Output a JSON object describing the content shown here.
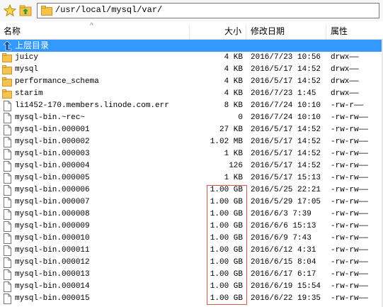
{
  "toolbar": {
    "favorite_icon": "star-icon",
    "up_icon": "folder-up-icon",
    "path": "/usr/local/mysql/var/"
  },
  "columns": {
    "name": "名称",
    "size": "大小",
    "modified": "修改日期",
    "attributes": "属性"
  },
  "parent_row": {
    "label": "上层目录",
    "icon": "parent-dir-icon"
  },
  "colors": {
    "selection": "#3399ff",
    "folder": "#f4c34b",
    "highlight_border": "#d9534f"
  },
  "files": [
    {
      "name": "juicy",
      "size": "4 KB",
      "date": "2016/7/23 10:56",
      "attr": "drwx——",
      "type": "folder"
    },
    {
      "name": "mysql",
      "size": "4 KB",
      "date": "2016/5/17 14:52",
      "attr": "drwx——",
      "type": "folder"
    },
    {
      "name": "performance_schema",
      "size": "4 KB",
      "date": "2016/5/17 14:52",
      "attr": "drwx——",
      "type": "folder"
    },
    {
      "name": "starim",
      "size": "4 KB",
      "date": "2016/7/23 1:45",
      "attr": "drwx——",
      "type": "folder"
    },
    {
      "name": "li1452-170.members.linode.com.err",
      "size": "8 KB",
      "date": "2016/7/24 10:10",
      "attr": "-rw-r——",
      "type": "file"
    },
    {
      "name": "mysql-bin.~rec~",
      "size": "0",
      "date": "2016/7/24 10:10",
      "attr": "-rw-rw——",
      "type": "file"
    },
    {
      "name": "mysql-bin.000001",
      "size": "27 KB",
      "date": "2016/5/17 14:52",
      "attr": "-rw-rw——",
      "type": "file"
    },
    {
      "name": "mysql-bin.000002",
      "size": "1.02 MB",
      "date": "2016/5/17 14:52",
      "attr": "-rw-rw——",
      "type": "file"
    },
    {
      "name": "mysql-bin.000003",
      "size": "1 KB",
      "date": "2016/5/17 14:52",
      "attr": "-rw-rw——",
      "type": "file"
    },
    {
      "name": "mysql-bin.000004",
      "size": "126",
      "date": "2016/5/17 14:52",
      "attr": "-rw-rw——",
      "type": "file"
    },
    {
      "name": "mysql-bin.000005",
      "size": "1 KB",
      "date": "2016/5/17 15:13",
      "attr": "-rw-rw——",
      "type": "file"
    },
    {
      "name": "mysql-bin.000006",
      "size": "1.00 GB",
      "date": "2016/5/25 22:21",
      "attr": "-rw-rw——",
      "type": "file"
    },
    {
      "name": "mysql-bin.000007",
      "size": "1.00 GB",
      "date": "2016/5/29 17:05",
      "attr": "-rw-rw——",
      "type": "file"
    },
    {
      "name": "mysql-bin.000008",
      "size": "1.00 GB",
      "date": "2016/6/3 7:39",
      "attr": "-rw-rw——",
      "type": "file"
    },
    {
      "name": "mysql-bin.000009",
      "size": "1.00 GB",
      "date": "2016/6/6 15:13",
      "attr": "-rw-rw——",
      "type": "file"
    },
    {
      "name": "mysql-bin.000010",
      "size": "1.00 GB",
      "date": "2016/6/9 7:43",
      "attr": "-rw-rw——",
      "type": "file"
    },
    {
      "name": "mysql-bin.000011",
      "size": "1.00 GB",
      "date": "2016/6/12 4:31",
      "attr": "-rw-rw——",
      "type": "file"
    },
    {
      "name": "mysql-bin.000012",
      "size": "1.00 GB",
      "date": "2016/6/15 8:04",
      "attr": "-rw-rw——",
      "type": "file"
    },
    {
      "name": "mysql-bin.000013",
      "size": "1.00 GB",
      "date": "2016/6/17 6:17",
      "attr": "-rw-rw——",
      "type": "file"
    },
    {
      "name": "mysql-bin.000014",
      "size": "1.00 GB",
      "date": "2016/6/19 15:54",
      "attr": "-rw-rw——",
      "type": "file"
    },
    {
      "name": "mysql-bin.000015",
      "size": "1.00 GB",
      "date": "2016/6/22 19:35",
      "attr": "-rw-rw——",
      "type": "file"
    }
  ]
}
